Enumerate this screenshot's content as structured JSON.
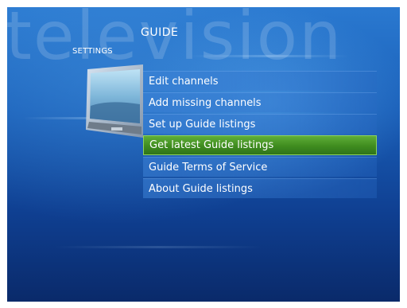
{
  "watermark": "television",
  "header": {
    "section_title": "GUIDE",
    "breadcrumb": "SETTINGS"
  },
  "menu": {
    "items": [
      {
        "label": "Edit channels",
        "selected": false
      },
      {
        "label": "Add missing channels",
        "selected": false
      },
      {
        "label": "Set up Guide listings",
        "selected": false
      },
      {
        "label": "Get latest Guide listings",
        "selected": true
      },
      {
        "label": "Guide Terms of Service",
        "selected": false
      },
      {
        "label": "About Guide listings",
        "selected": false
      }
    ]
  },
  "colors": {
    "background": "#1a5fb8",
    "selected_item": "#3f8c1f",
    "text": "#ffffff"
  },
  "icons": {
    "thumbnail": "television-icon"
  }
}
